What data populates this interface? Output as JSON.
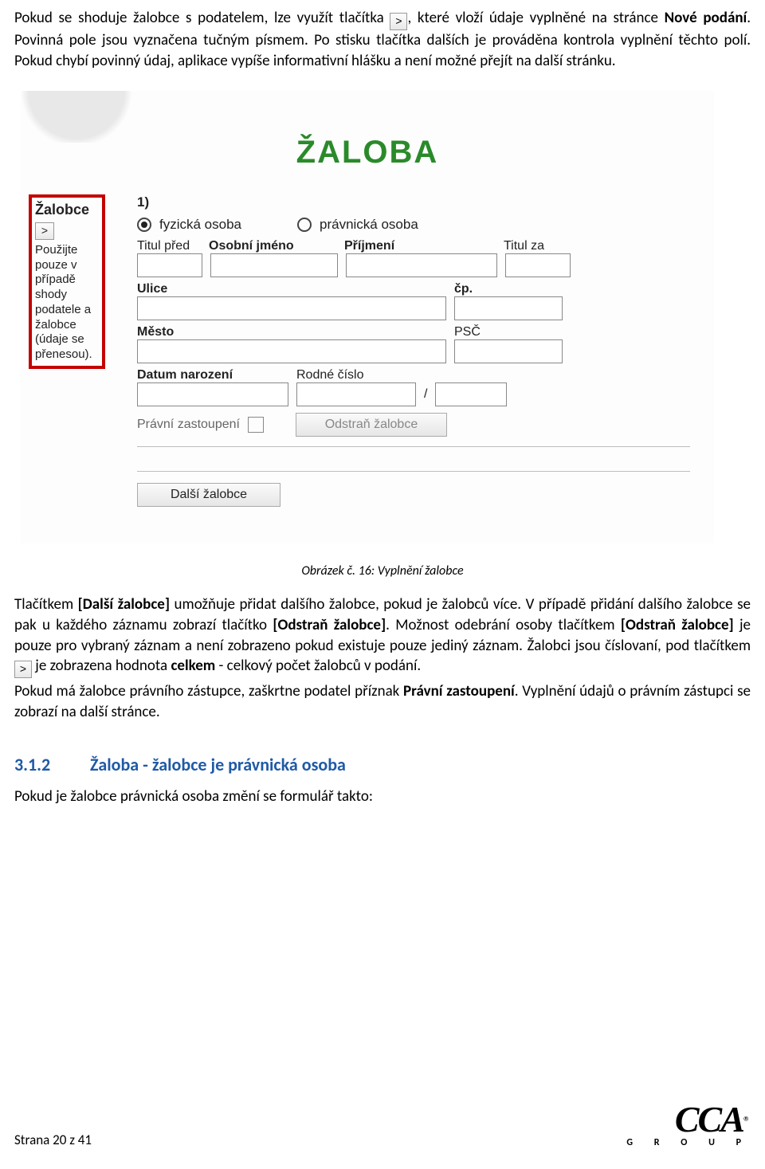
{
  "para1": {
    "t1": "Pokud se shoduje žalobce s podatelem, lze využít tlačítka ",
    "btn": ">",
    "t2": ", které vloží údaje vyplněné na stránce ",
    "bold1": "Nové podání",
    "t3": ". Povinná pole jsou vyznačena tučným písmem. Po stisku tlačítka dalších je prováděna kontrola vyplnění těchto polí. Pokud chybí povinný údaj, aplikace vypíše informativní hlášku a není možné přejít na další stránku."
  },
  "app": {
    "title": "ŽALOBA",
    "num": "1)",
    "radio_fyz": "fyzická osoba",
    "radio_prav": "právnická osoba",
    "labels": {
      "titul_pred": "Titul před",
      "osobni_jmeno": "Osobní jméno",
      "prijmeni": "Příjmení",
      "titul_za": "Titul za",
      "ulice": "Ulice",
      "cp": "čp.",
      "mesto": "Město",
      "psc": "PSČ",
      "datum_nar": "Datum narození",
      "rodne_cislo": "Rodné číslo",
      "slash": "/",
      "pravni_zast": "Právní zastoupení",
      "odstran": "Odstraň žalobce",
      "dalsi": "Další žalobce"
    },
    "sidebar": {
      "title": "Žalobce",
      "btn": ">",
      "hint": "Použijte pouze v případě shody podatele a žalobce (údaje se přenesou)."
    }
  },
  "caption": "Obrázek č. 16: Vyplnění žalobce",
  "para2": {
    "t1": "Tlačítkem ",
    "b1": "[Další žalobce]",
    "t2": " umožňuje přidat dalšího žalobce, pokud je žalobců více. V případě přidání dalšího žalobce se pak u každého záznamu zobrazí tlačítko ",
    "b2": "[Odstraň žalobce]",
    "t3": ". Možnost odebrání osoby tlačítkem ",
    "b3": "[Odstraň žalobce]",
    "t4": " je pouze pro vybraný záznam a není zobrazeno pokud existuje pouze jediný záznam. Žalobci jsou číslovaní, pod tlačítkem ",
    "btn": ">",
    "t5": " je zobrazena hodnota ",
    "b4": "celkem",
    "t6": " - celkový počet žalobců v podání."
  },
  "para3": {
    "t1": "Pokud má žalobce právního zástupce, zaškrtne podatel příznak ",
    "b1": "Právní zastoupení",
    "t2": ". Vyplnění údajů o právním zástupci se zobrazí na další stránce."
  },
  "section": {
    "num": "3.1.2",
    "title": "Žaloba - žalobce je právnická osoba"
  },
  "para4": "Pokud je žalobce právnická osoba změní se formulář takto:",
  "footer": {
    "page": "Strana 20 z 41",
    "logo": "CCA",
    "sub": "G R O U P",
    "reg": "®"
  }
}
